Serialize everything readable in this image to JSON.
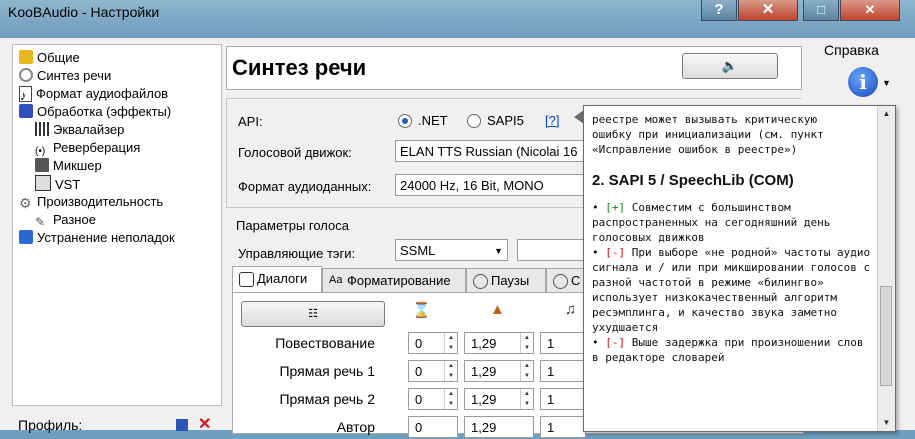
{
  "window": {
    "title": "KooBAudio - Настройки",
    "help_btn": "?",
    "close_btn": "✕"
  },
  "tree": {
    "items": [
      {
        "label": "Общие",
        "icon": "folder-icon",
        "color": "#e8b820"
      },
      {
        "label": "Синтез речи",
        "icon": "speech-icon",
        "color": "#888"
      },
      {
        "label": "Формат аудиофайлов",
        "icon": "audio-file-icon",
        "color": "#444"
      },
      {
        "label": "Обработка (эффекты)",
        "icon": "effects-icon",
        "color": "#3050c0"
      },
      {
        "label": "Эквалайзер",
        "icon": "equalizer-icon",
        "color": "#333"
      },
      {
        "label": "Реверберация",
        "icon": "reverb-icon",
        "color": "#333"
      },
      {
        "label": "Микшер",
        "icon": "mixer-icon",
        "color": "#333"
      },
      {
        "label": "VST",
        "icon": "vst-icon",
        "color": "#333"
      },
      {
        "label": "Производительность",
        "icon": "gear-icon",
        "color": "#666"
      },
      {
        "label": "Разное",
        "icon": "tools-icon",
        "color": "#555"
      },
      {
        "label": "Устранение неполадок",
        "icon": "troubleshoot-icon",
        "color": "#2a6ad0"
      }
    ]
  },
  "profile": {
    "label": "Профиль:",
    "delete": "✕"
  },
  "page": {
    "title": "Синтез речи",
    "api_label": "API:",
    "api_net": ".NET",
    "api_sapi": "SAPI5",
    "api_help": "[?]",
    "voice_engine_label": "Голосовой движок:",
    "voice_engine_value": "ELAN TTS Russian (Nicolai 16",
    "audio_format_label": "Формат аудиоданных:",
    "audio_format_value": "24000 Hz, 16 Bit, MONO",
    "voice_params_label": "Параметры голоса",
    "control_tags_label": "Управляющие тэги:",
    "control_tags_value": "SSML"
  },
  "tabs": [
    {
      "label": "Диалоги",
      "icon": "dialog-icon"
    },
    {
      "label": "Форматирование",
      "icon": "format-icon"
    },
    {
      "label": "Паузы",
      "icon": "pause-icon"
    },
    {
      "label": "С",
      "icon": "other-icon"
    }
  ],
  "rows": [
    {
      "label": "Повествование",
      "v1": "0",
      "v2": "1,29",
      "v3": "1"
    },
    {
      "label": "Прямая речь 1",
      "v1": "0",
      "v2": "1,29",
      "v3": "1"
    },
    {
      "label": "Прямая речь 2",
      "v1": "0",
      "v2": "1,29",
      "v3": "1"
    },
    {
      "label": "Автор",
      "v1": "0",
      "v2": "1,29",
      "v3": "1"
    }
  ],
  "side": {
    "help": "Справка",
    "info": "i",
    "max": "□",
    "close": "✕"
  },
  "tooltip": {
    "l1": "реестре может вызывать критическую",
    "l2": "ошибку при инициализации (см. пункт",
    "l3": "«Исправление ошибок в реестре»)",
    "heading": "2. SAPI 5 / SpeechLib (COM)",
    "plus": "[+]",
    "minus": "[-]",
    "p1": " Совместим с большинством распространенных на сегодняшний день голосовых движков",
    "p2": " При выборе «не родной» частоты аудио сигнала и / или при микшировании голосов с разной частотой в режиме «билингво» использует низкокачественный алгоритм ресэмплинга, и качество звука заметно ухудшается",
    "p3": " Выше задержка при произношении слов в редакторе словарей"
  }
}
